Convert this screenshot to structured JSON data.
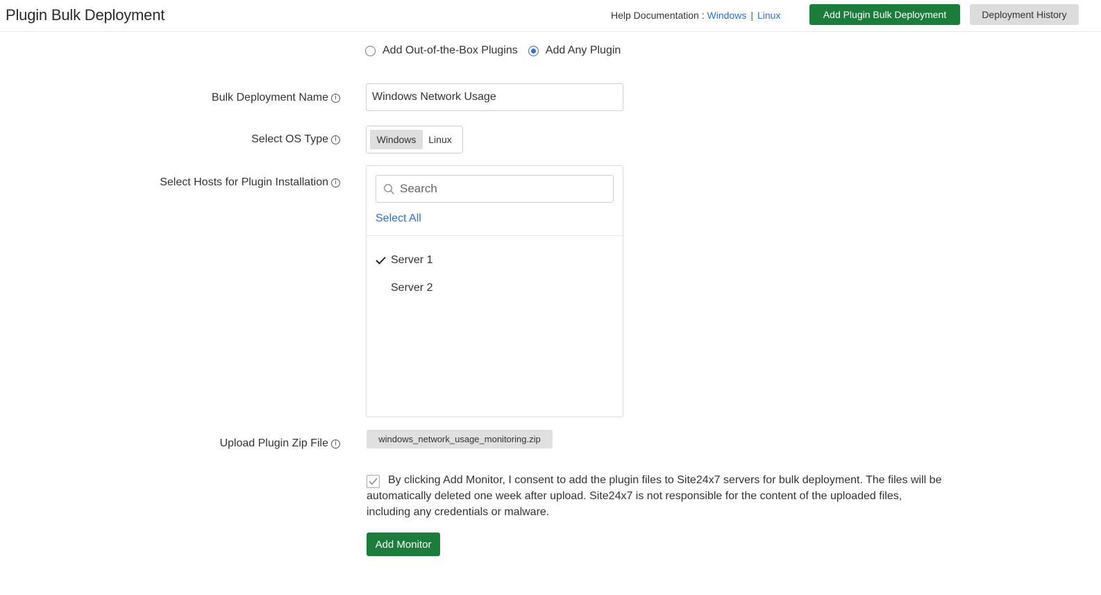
{
  "header": {
    "title": "Plugin Bulk Deployment",
    "help_label": "Help Documentation :",
    "help_links": [
      "Windows",
      "Linux"
    ],
    "separator": "|",
    "add_button": "Add Plugin Bulk Deployment",
    "history_button": "Deployment History"
  },
  "plugin_type": {
    "options": [
      "Add Out-of-the-Box Plugins",
      "Add Any Plugin"
    ],
    "selected": "Add Any Plugin"
  },
  "form": {
    "name_label": "Bulk Deployment Name",
    "name_value": "Windows Network Usage",
    "os_label": "Select OS Type",
    "os_options": [
      "Windows",
      "Linux"
    ],
    "os_selected": "Windows",
    "hosts_label": "Select Hosts for Plugin Installation",
    "search_placeholder": "Search",
    "select_all": "Select All",
    "hosts": [
      {
        "name": "Server 1",
        "selected": true
      },
      {
        "name": "Server 2",
        "selected": false
      }
    ],
    "upload_label": "Upload Plugin Zip File",
    "uploaded_file": "windows_network_usage_monitoring.zip",
    "consent_checked": true,
    "consent_text": "By clicking Add Monitor, I consent to add the plugin files to Site24x7 servers for bulk deployment. The files will be automatically deleted one week after upload. Site24x7 is not responsible for the content of the uploaded files, including any credentials or malware.",
    "submit_button": "Add Monitor"
  },
  "icons": {
    "info": "info-circle-icon",
    "search": "search-icon",
    "check": "checkmark-icon"
  },
  "colors": {
    "primary_green": "#1c7c3c",
    "link_blue": "#2f6fd6",
    "secondary_gray": "#dcdcdc"
  }
}
